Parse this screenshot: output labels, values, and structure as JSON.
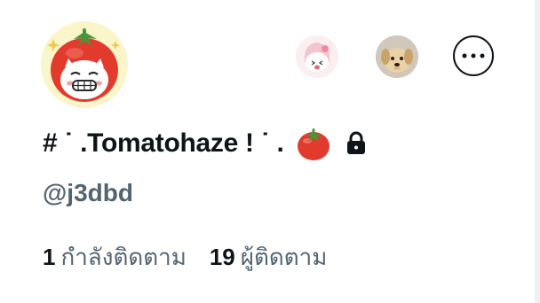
{
  "profile": {
    "display_name": "# ˙ .Tomatohaze ! ˙ .",
    "handle": "@j3dbd",
    "name_emoji": "tomato-icon",
    "protected_icon": "lock-icon"
  },
  "stats": {
    "following_count": "1",
    "following_label": "กำลังติดตาม",
    "followers_count": "19",
    "followers_label": "ผู้ติดตาม"
  },
  "actions": {
    "follower_avatars": [
      "melody-avatar",
      "puppy-avatar"
    ],
    "more_icon": "more-options-icon"
  },
  "colors": {
    "text_primary": "#0f1419",
    "text_secondary": "#536471",
    "avatar_bg": "#fbf6c9",
    "tomato_red": "#e23b2e"
  }
}
